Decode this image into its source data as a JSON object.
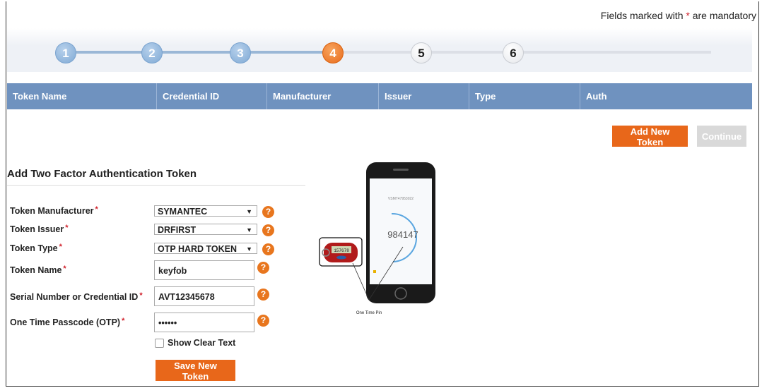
{
  "header": {
    "mandatory_prefix": "Fields marked with",
    "mandatory_star": "*",
    "mandatory_suffix": "are mandatory"
  },
  "wizard": {
    "current_step": 4,
    "steps": [
      {
        "label": "1",
        "state": "done"
      },
      {
        "label": "2",
        "state": "done"
      },
      {
        "label": "3",
        "state": "done"
      },
      {
        "label": "4",
        "state": "current"
      },
      {
        "label": "5",
        "state": "todo"
      },
      {
        "label": "6",
        "state": "todo"
      }
    ]
  },
  "token_grid": {
    "columns": [
      "Token Name",
      "Credential ID",
      "Manufacturer",
      "Issuer",
      "Type",
      "Auth"
    ],
    "rows": []
  },
  "actions": {
    "add_new_token": "Add New Token",
    "continue": "Continue"
  },
  "form": {
    "title": "Add Two Factor Authentication Token",
    "required_marker": "*",
    "token_manufacturer": {
      "label": "Token Manufacturer",
      "value": "SYMANTEC"
    },
    "token_issuer": {
      "label": "Token Issuer",
      "value": "DRFIRST"
    },
    "token_type": {
      "label": "Token Type",
      "value": "OTP HARD TOKEN"
    },
    "token_name": {
      "label": "Token Name",
      "value": "keyfob"
    },
    "serial_number": {
      "label": "Serial Number or Credential ID",
      "value": "AVT12345678"
    },
    "otp": {
      "label": "One Time Passcode (OTP)",
      "value": "••••••"
    },
    "show_clear_text": {
      "label": "Show Clear Text",
      "checked": false
    },
    "save_button": "Save New Token",
    "help_glyph": "?"
  },
  "illustration": {
    "phone_code": "984147",
    "credential_id_caption": "VSMT47953022",
    "keyfob_code": "157678",
    "pointer_caption": "One Time Pin"
  },
  "colors": {
    "accent_orange": "#e8671a",
    "grid_header": "#6f92bf",
    "required_red": "#d0202a"
  }
}
